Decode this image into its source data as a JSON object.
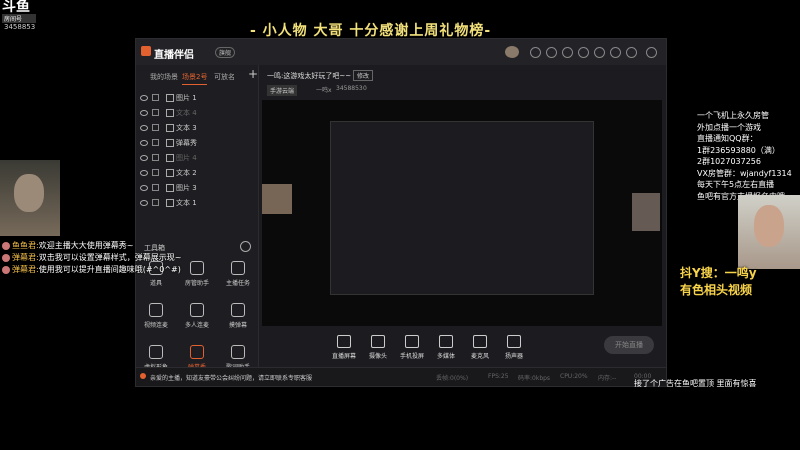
{
  "overlay": {
    "logo_big": "斗鱼",
    "logo_small": "房间号",
    "room_id": "3458853",
    "banner": "- 小人物 大哥  十分感谢上周礼物榜-"
  },
  "app": {
    "title": "直播伴侣",
    "version_badge": "旗舰",
    "left_tabs": [
      "我的场景",
      "场景2号",
      "可放名"
    ],
    "sources": [
      {
        "label": "图片 1",
        "dim": false
      },
      {
        "label": "文本 4",
        "dim": true
      },
      {
        "label": "文本 3",
        "dim": false
      },
      {
        "label": "弹幕秀",
        "dim": false
      },
      {
        "label": "图片 4",
        "dim": true
      },
      {
        "label": "文本 2",
        "dim": false
      },
      {
        "label": "图片 3",
        "dim": false
      },
      {
        "label": "文本 1",
        "dim": false
      }
    ],
    "tools_title": "工具箱",
    "tools": [
      {
        "label": "道具",
        "hl": false
      },
      {
        "label": "房管助手",
        "hl": false
      },
      {
        "label": "主播任务",
        "hl": false
      },
      {
        "label": "视频连麦",
        "hl": false
      },
      {
        "label": "多人连麦",
        "hl": false
      },
      {
        "label": "摸弹幕",
        "hl": false
      },
      {
        "label": "虚拟形象",
        "hl": false
      },
      {
        "label": "弹幕秀",
        "hl": true
      },
      {
        "label": "歌词助手",
        "hl": false
      }
    ],
    "stream_title": "一鸣:这游戏太好玩了吧~~",
    "edit_label": "修改",
    "category": "手游云端",
    "fans_label": "一鸣x",
    "uid": "3458853",
    "hot": "0",
    "bottom_tools": [
      "直播屏幕",
      "摄像头",
      "手机投屏",
      "多媒体",
      "麦克风",
      "扬声器"
    ],
    "start_label": "开始直播",
    "notice": "亲爱的主播，知道友豪带公会纠纷问题，请立即联系专职客服",
    "stats": [
      "丢帧:0(0%)",
      "FPS:25",
      "码率:0kbps",
      "CPU:20%",
      "内存:--",
      "00:00"
    ]
  },
  "chat": [
    {
      "name": "鱼鱼君:",
      "text": "欢迎主播大大使用弹幕秀~"
    },
    {
      "name": "弹幕君:",
      "text": "双击我可以设置弹幕样式，弹幕展示现~"
    },
    {
      "name": "弹幕君:",
      "text": "使用我可以提升直播间趣味哦(#^0^#)"
    }
  ],
  "right_info": [
    "一个飞机上永久房管",
    "外加点播一个游戏",
    "直播通知QQ群：",
    "1群236593880（满）",
    "2群1027037256",
    "VX房管群：wjandyf1314",
    "每天下午5点左右直播",
    "鱼吧有官方支援报名中哦"
  ],
  "promo": [
    "抖Y搜：一鸣y",
    "有色相头视频"
  ],
  "ad_text": "接了个广告在鱼吧置顶 里面有惊喜"
}
